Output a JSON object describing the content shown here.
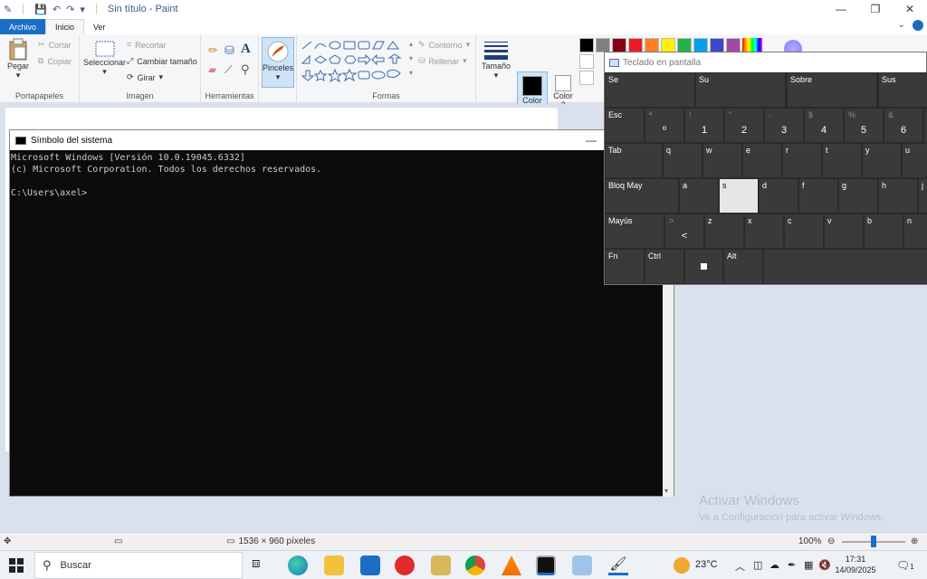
{
  "titlebar": {
    "title": "Sin título - Paint",
    "min": "—",
    "max": "❐",
    "close": "✕"
  },
  "tabs": {
    "file": "Archivo",
    "home": "Inicio",
    "view": "Ver"
  },
  "ribbon": {
    "portapapeles": {
      "paste": "Pegar",
      "cut": "Cortar",
      "copy": "Copiar",
      "label": "Portapapeles"
    },
    "imagen": {
      "select": "Seleccionar",
      "crop": "Recortar",
      "resize": "Cambiar tamaño",
      "rotate": "Girar",
      "label": "Imagen"
    },
    "herramientas": {
      "label": "Herramientas"
    },
    "pinceles": {
      "label": "Pinceles"
    },
    "formas": {
      "outline": "Contorno",
      "fill": "Rellenar",
      "label": "Formas"
    },
    "tamano": {
      "label": "Tamaño"
    },
    "color1": {
      "label": "Color",
      "num": "1"
    },
    "color2": {
      "label": "Color",
      "num": "2"
    },
    "palette": [
      "#000000",
      "#7f7f7f",
      "#880015",
      "#ed1c24",
      "#ff7f27",
      "#fff200",
      "#22b14c",
      "#00a2e8",
      "#3f48cc",
      "#a349a4"
    ]
  },
  "status": {
    "dimensions": "1536 × 960 píxeles",
    "zoom": "100%"
  },
  "cmd": {
    "title": "Símbolo del sistema",
    "lines": [
      "Microsoft Windows [Versión 10.0.19045.6332]",
      "(c) Microsoft Corporation. Todos los derechos reservados.",
      "",
      "C:\\Users\\axel>"
    ]
  },
  "osk": {
    "title": "Teclado en pantalla",
    "row0": [
      "Se",
      "Su",
      "Sobre",
      "Sus"
    ],
    "row1": [
      {
        "top": "Esc",
        "main": ""
      },
      {
        "sub": "ª",
        "main": "º"
      },
      {
        "sub": "!",
        "main": "1"
      },
      {
        "sub": "\"",
        "main": "2"
      },
      {
        "sub": "·",
        "main": "3"
      },
      {
        "sub": "$",
        "main": "4"
      },
      {
        "sub": "%",
        "main": "5"
      },
      {
        "sub": "&",
        "main": "6"
      },
      {
        "sub": "/",
        "main": ""
      }
    ],
    "row2": [
      "Tab",
      "q",
      "w",
      "e",
      "r",
      "t",
      "y",
      "u"
    ],
    "row3": [
      "Bloq May",
      "a",
      "s",
      "d",
      "f",
      "g",
      "h",
      "j"
    ],
    "row4": [
      {
        "top": "Mayús",
        "main": ""
      },
      {
        "sub": ">",
        "main": "<"
      },
      {
        "top": "z",
        "main": ""
      },
      {
        "top": "x",
        "main": ""
      },
      {
        "top": "c",
        "main": ""
      },
      {
        "top": "v",
        "main": ""
      },
      {
        "top": "b",
        "main": ""
      },
      {
        "top": "n",
        "main": ""
      }
    ],
    "row5": [
      "Fn",
      "Ctrl",
      "",
      "Alt",
      ""
    ]
  },
  "watermark": {
    "line1": "Activar Windows",
    "line2": "Ve a Configuración para activar Windows."
  },
  "taskbar": {
    "search": "Buscar",
    "temp": "23°C",
    "time": "17:31",
    "date": "14/09/2025",
    "notif": "1"
  }
}
